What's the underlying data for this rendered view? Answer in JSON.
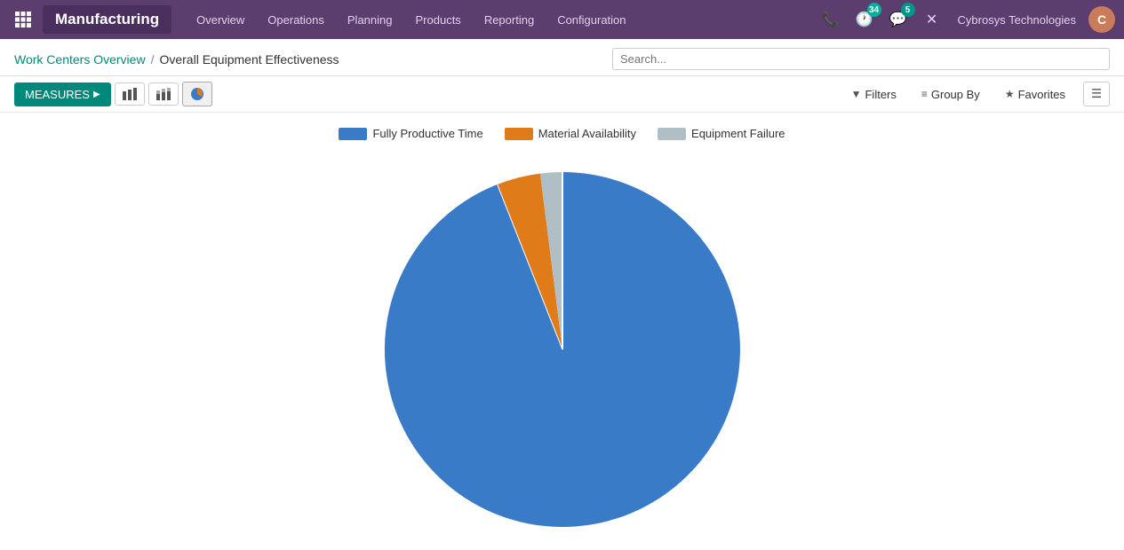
{
  "topnav": {
    "brand": "Manufacturing",
    "links": [
      "Overview",
      "Operations",
      "Planning",
      "Products",
      "Reporting",
      "Configuration"
    ],
    "phone_icon": "📞",
    "activity_count": "34",
    "message_count": "5",
    "company": "Cybrosys Technologies"
  },
  "breadcrumb": {
    "parent": "Work Centers Overview",
    "separator": "/",
    "current": "Overall Equipment Effectiveness"
  },
  "search": {
    "placeholder": "Search..."
  },
  "toolbar": {
    "measures_label": "MEASURES",
    "filters_label": "Filters",
    "groupby_label": "Group By",
    "favorites_label": "Favorites"
  },
  "chart": {
    "legend": [
      {
        "label": "Fully Productive Time",
        "color": "#3a7bc8"
      },
      {
        "label": "Material Availability",
        "color": "#e07b1a"
      },
      {
        "label": "Equipment Failure",
        "color": "#b0bec5"
      }
    ],
    "slices": [
      {
        "label": "Fully Productive Time",
        "value": 94,
        "color": "#3a7bc8"
      },
      {
        "label": "Material Availability",
        "value": 4,
        "color": "#e07b1a"
      },
      {
        "label": "Equipment Failure",
        "value": 2,
        "color": "#b0bec5"
      }
    ]
  }
}
